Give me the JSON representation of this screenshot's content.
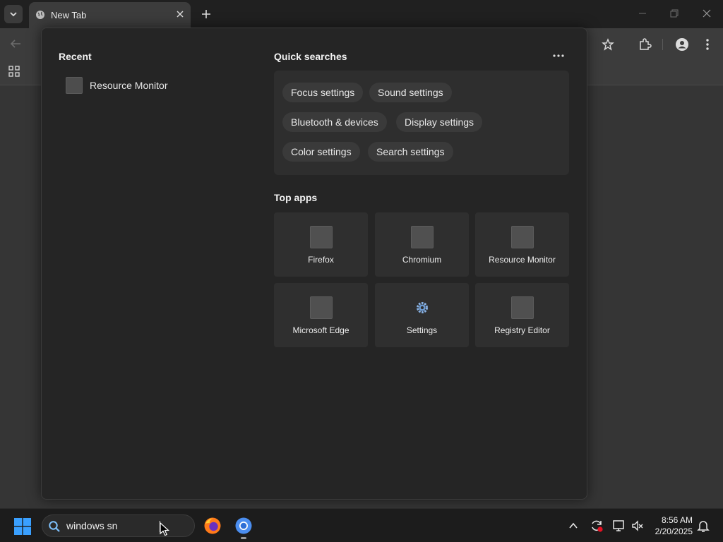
{
  "browser": {
    "tab_title": "New Tab"
  },
  "flyout": {
    "recent": {
      "title": "Recent",
      "items": [
        {
          "label": "Resource Monitor"
        }
      ]
    },
    "quick_searches": {
      "title": "Quick searches",
      "chips": [
        {
          "label": "Focus settings"
        },
        {
          "label": "Sound settings"
        },
        {
          "label": "Bluetooth & devices"
        },
        {
          "label": "Display settings"
        },
        {
          "label": "Color settings"
        },
        {
          "label": "Search settings"
        }
      ]
    },
    "top_apps": {
      "title": "Top apps",
      "apps": [
        {
          "label": "Firefox",
          "icon": "app-placeholder-icon"
        },
        {
          "label": "Chromium",
          "icon": "app-placeholder-icon"
        },
        {
          "label": "Resource Monitor",
          "icon": "app-placeholder-icon"
        },
        {
          "label": "Microsoft Edge",
          "icon": "app-placeholder-icon"
        },
        {
          "label": "Settings",
          "icon": "gear-icon"
        },
        {
          "label": "Registry Editor",
          "icon": "app-placeholder-icon"
        }
      ]
    }
  },
  "taskbar": {
    "search_value": "windows sn",
    "time": "8:56 AM",
    "date": "2/20/2025"
  },
  "colors": {
    "start_blue": "#3aa0ff",
    "firefox_orange": "#ff7a1a",
    "chromium_blue": "#4b8ef0",
    "update_red": "#e81123"
  }
}
